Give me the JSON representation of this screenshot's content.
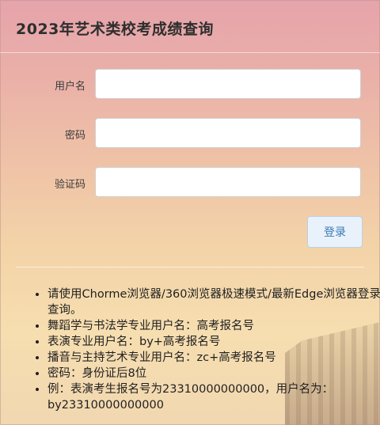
{
  "header": {
    "title": "2023年艺术类校考成绩查询"
  },
  "form": {
    "username_label": "用户名",
    "username_value": "",
    "password_label": "密码",
    "password_value": "",
    "captcha_label": "验证码",
    "captcha_value": "",
    "login_label": "登录"
  },
  "notes": [
    "请使用Chorme浏览器/360浏览器极速模式/最新Edge浏览器登录查询。",
    "舞蹈学与书法学专业用户名：高考报名号",
    "表演专业用户名：by+高考报名号",
    "播音与主持艺术专业用户名：zc+高考报名号",
    "密码：身份证后8位",
    "例：表演考生报名号为23310000000000，用户名为：by23310000000000"
  ]
}
